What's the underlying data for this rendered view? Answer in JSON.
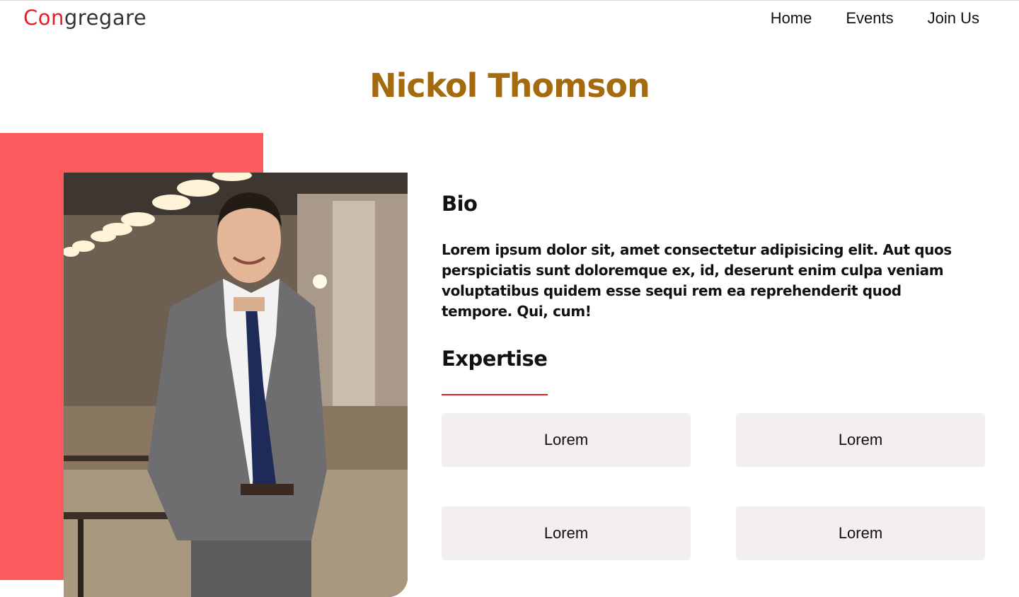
{
  "logo": {
    "accent": "Con",
    "rest": "gregare"
  },
  "nav": {
    "items": [
      "Home",
      "Events",
      "Join Us"
    ]
  },
  "profile": {
    "name": "Nickol Thomson",
    "photo_alt": "Portrait of man in grey suit and navy tie"
  },
  "bio": {
    "heading": "Bio",
    "text": "Lorem ipsum dolor sit, amet consectetur adipisicing elit. Aut quos perspiciatis sunt doloremque ex, id, deserunt enim culpa veniam voluptatibus quidem esse sequi rem ea reprehenderit quod tempore. Qui, cum!"
  },
  "expertise": {
    "heading": "Expertise",
    "items": [
      "Lorem",
      "Lorem",
      "Lorem",
      "Lorem"
    ]
  },
  "colors": {
    "brand_red": "#ec1c24",
    "title_gold": "#a46b0e",
    "accent_block": "#fd5a5f",
    "chip_bg": "#f3eeef"
  }
}
